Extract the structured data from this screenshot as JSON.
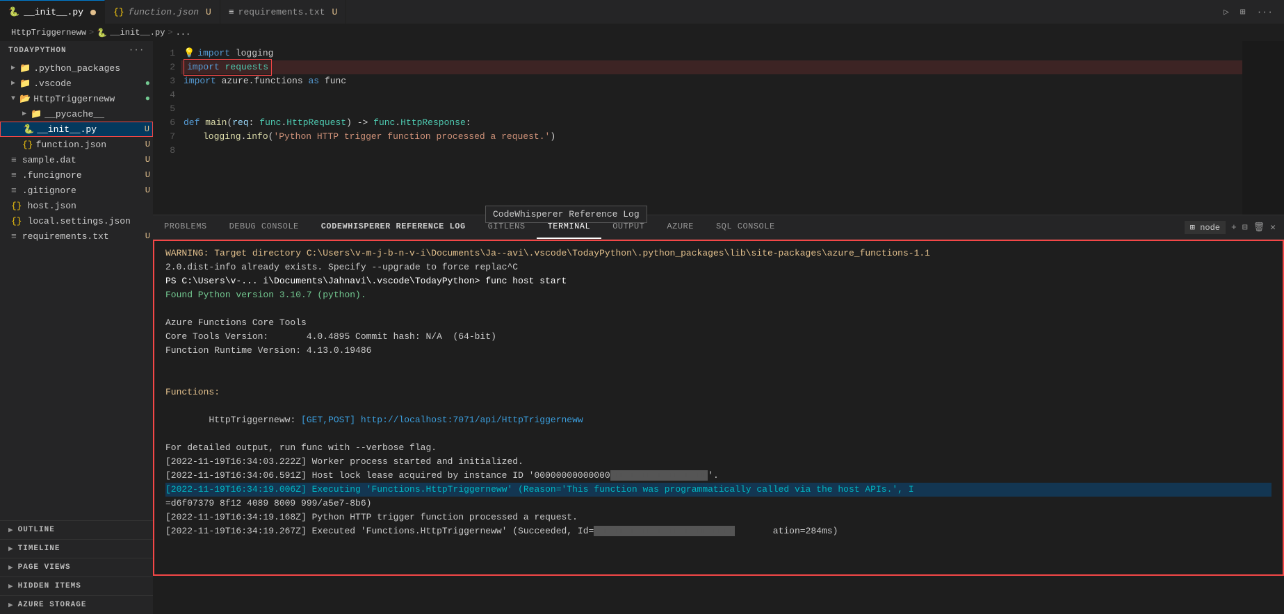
{
  "tabs": {
    "items": [
      {
        "label": "__init__.py",
        "icon": "py",
        "modified": true,
        "active": true,
        "dotted": false
      },
      {
        "label": "function.json",
        "icon": "json",
        "modified": true,
        "active": false
      },
      {
        "label": "requirements.txt",
        "icon": "txt",
        "modified": true,
        "active": false
      }
    ]
  },
  "breadcrumb": {
    "parts": [
      "HttpTriggerneww",
      ">",
      "__init__.py",
      ">",
      "..."
    ]
  },
  "editor": {
    "lines": [
      {
        "num": "1",
        "content_raw": "import logging",
        "special": "lightbulb"
      },
      {
        "num": "2",
        "content_raw": "import requests",
        "special": "highlight_box"
      },
      {
        "num": "3",
        "content_raw": "import azure.functions as func"
      },
      {
        "num": "4",
        "content_raw": ""
      },
      {
        "num": "5",
        "content_raw": ""
      },
      {
        "num": "6",
        "content_raw": "def main(req: func.HttpRequest) -> func.HttpResponse:"
      },
      {
        "num": "7",
        "content_raw": "    logging.info('Python HTTP trigger function processed a request.')"
      },
      {
        "num": "8",
        "content_raw": ""
      }
    ]
  },
  "tooltip": "CodeWhisperer Reference Log",
  "sidebar": {
    "title": "TODAYPYTHON",
    "items": [
      {
        "label": ".python_packages",
        "type": "folder",
        "indent": 1,
        "badge": "",
        "collapsed": true
      },
      {
        "label": ".vscode",
        "type": "folder",
        "indent": 1,
        "badge": "green_dot",
        "collapsed": true
      },
      {
        "label": "HttpTriggerneww",
        "type": "folder",
        "indent": 1,
        "badge": "green_dot",
        "expanded": true
      },
      {
        "label": "__pycache__",
        "type": "folder",
        "indent": 2,
        "badge": "",
        "collapsed": true
      },
      {
        "label": "__init__.py",
        "type": "py",
        "indent": 2,
        "badge": "U",
        "selected": true
      },
      {
        "label": "function.json",
        "type": "json",
        "indent": 2,
        "badge": "U"
      },
      {
        "label": "sample.dat",
        "type": "dat",
        "indent": 1,
        "badge": "U"
      },
      {
        "label": ".funcignore",
        "type": "file",
        "indent": 1,
        "badge": "U"
      },
      {
        "label": ".gitignore",
        "type": "file",
        "indent": 1,
        "badge": "U"
      },
      {
        "label": "host.json",
        "type": "json",
        "indent": 1,
        "badge": ""
      },
      {
        "label": "local.settings.json",
        "type": "json",
        "indent": 1,
        "badge": ""
      },
      {
        "label": "requirements.txt",
        "type": "txt",
        "indent": 1,
        "badge": "U"
      }
    ],
    "sections": [
      {
        "label": "OUTLINE"
      },
      {
        "label": "TIMELINE"
      },
      {
        "label": "PAGE VIEWS"
      },
      {
        "label": "HIDDEN ITEMS"
      },
      {
        "label": "AZURE STORAGE"
      }
    ]
  },
  "panel": {
    "tabs": [
      {
        "label": "PROBLEMS"
      },
      {
        "label": "DEBUG CONSOLE"
      },
      {
        "label": "CODEWHISPERER REFERENCE LOG",
        "active": true
      },
      {
        "label": "GITLENS"
      },
      {
        "label": "TERMINAL"
      },
      {
        "label": "OUTPUT"
      },
      {
        "label": "AZURE"
      },
      {
        "label": "SQL CONSOLE"
      }
    ],
    "terminal_node_label": "node"
  },
  "terminal": {
    "lines": [
      {
        "text": "WARNING: Target directory C:\\Users\\v-m-j-b-n-v-i\\Documents\\Ja--avi\\.vscode\\TodayPython\\.python_packages\\lib\\site-packages\\azure_functions-1.1",
        "class": "t-warning"
      },
      {
        "text": "2.0.dist-info already exists. Specify --upgrade to force replac^C",
        "class": "t-normal"
      },
      {
        "text": "PS C:\\Users\\v-... i\\Documents\\Jahnavi\\.vscode\\TodayPython> func host start",
        "class": "t-cmd"
      },
      {
        "text": "Found Python version 3.10.7 (python).",
        "class": "t-green"
      },
      {
        "text": "",
        "class": "t-normal"
      },
      {
        "text": "Azure Functions Core Tools",
        "class": "t-normal"
      },
      {
        "text": "Core Tools Version:       4.0.4895 Commit hash: N/A  (64-bit)",
        "class": "t-normal"
      },
      {
        "text": "Function Runtime Version: 4.13.0.19486",
        "class": "t-normal"
      },
      {
        "text": "",
        "class": "t-normal"
      },
      {
        "text": "",
        "class": "t-normal"
      },
      {
        "text": "Functions:",
        "class": "t-yellow"
      },
      {
        "text": "",
        "class": "t-normal"
      },
      {
        "text": "        HttpTriggerneww: [GET,POST] http://localhost:7071/api/HttpTriggerneww",
        "class": "t-url"
      },
      {
        "text": "",
        "class": "t-normal"
      },
      {
        "text": "For detailed output, run func with --verbose flag.",
        "class": "t-normal"
      },
      {
        "text": "[2022-11-19T16:34:03.222Z] Worker process started and initialized.",
        "class": "t-normal"
      },
      {
        "text": "[2022-11-19T16:34:06.591Z] Host lock lease acquired by instance ID '00000000000000--■■■■■■■■■■■'.",
        "class": "t-normal"
      },
      {
        "text": "[2022-11-19T16:34:19.006Z] Executing 'Functions.HttpTriggerneww' (Reason='This function was programmatically called via the host APIs.', I",
        "class": "t-highlight-line t-cyan"
      },
      {
        "text": "=d6f07379 8f12 4089 8009 999/a5e7-8b6)",
        "class": "t-normal"
      },
      {
        "text": "[2022-11-19T16:34:19.168Z] Python HTTP trigger function processed a request.",
        "class": "t-normal"
      },
      {
        "text": "[2022-11-19T16:34:19.267Z] Executed 'Functions.HttpTriggerneww' (Succeeded, Id=■■■■■■■■■■■■■■■■■■■■■■■■■■■■■■       ation=284ms)",
        "class": "t-normal"
      }
    ]
  }
}
